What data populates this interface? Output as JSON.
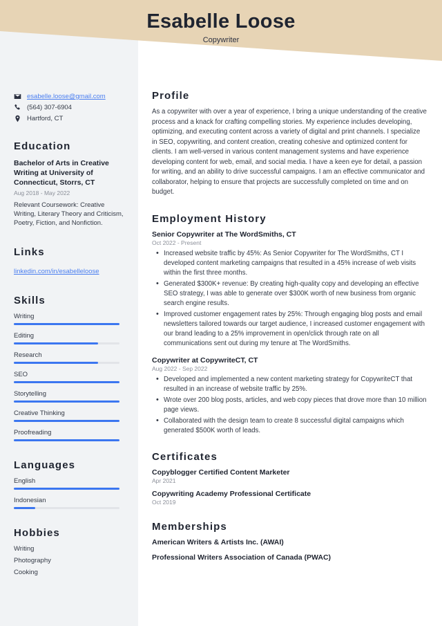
{
  "colors": {
    "header_band": "#e7d4b5",
    "sidebar_bg": "#f1f3f5",
    "accent_blue": "#3b76f0",
    "link_blue": "#4a7ef0",
    "heading_dark": "#1f2430",
    "muted_gray": "#8b8f99"
  },
  "header": {
    "name": "Esabelle Loose",
    "title": "Copywriter"
  },
  "contact": {
    "email": "esabelle.loose@gmail.com",
    "phone": "(564) 307-6904",
    "location": "Hartford, CT",
    "email_icon": "envelope-icon",
    "phone_icon": "phone-icon",
    "location_icon": "map-pin-icon"
  },
  "sidebar": {
    "education": {
      "heading": "Education",
      "entries": [
        {
          "degree": "Bachelor of Arts in Creative Writing at University of Connecticut, Storrs, CT",
          "date": "Aug 2018 - May 2022",
          "description": "Relevant Coursework: Creative Writing, Literary Theory and Criticism, Poetry, Fiction, and Nonfiction."
        }
      ]
    },
    "links": {
      "heading": "Links",
      "items": [
        {
          "label": "linkedin.com/in/esabelleloose"
        }
      ]
    },
    "skills": {
      "heading": "Skills",
      "items": [
        {
          "label": "Writing",
          "level": 100
        },
        {
          "label": "Editing",
          "level": 80
        },
        {
          "label": "Research",
          "level": 80
        },
        {
          "label": "SEO",
          "level": 100
        },
        {
          "label": "Storytelling",
          "level": 100
        },
        {
          "label": "Creative Thinking",
          "level": 100
        },
        {
          "label": "Proofreading",
          "level": 100
        }
      ]
    },
    "languages": {
      "heading": "Languages",
      "items": [
        {
          "label": "English",
          "level": 100
        },
        {
          "label": "Indonesian",
          "level": 20
        }
      ]
    },
    "hobbies": {
      "heading": "Hobbies",
      "items": [
        {
          "label": "Writing"
        },
        {
          "label": "Photography"
        },
        {
          "label": "Cooking"
        }
      ]
    }
  },
  "main": {
    "profile": {
      "heading": "Profile",
      "text": "As a copywriter with over a year of experience, I bring a unique understanding of the creative process and a knack for crafting compelling stories. My experience includes developing, optimizing, and executing content across a variety of digital and print channels. I specialize in SEO, copywriting, and content creation, creating cohesive and optimized content for clients. I am well-versed in various content management systems and have experience developing content for web, email, and social media. I have a keen eye for detail, a passion for writing, and an ability to drive successful campaigns. I am an effective communicator and collaborator, helping to ensure that projects are successfully completed on time and on budget."
    },
    "employment": {
      "heading": "Employment History",
      "jobs": [
        {
          "title": "Senior Copywriter at The WordSmiths, CT",
          "date": "Oct 2022 - Present",
          "bullets": [
            "Increased website traffic by 45%: As Senior Copywriter for The WordSmiths, CT I developed content marketing campaigns that resulted in a 45% increase of web visits within the first three months.",
            "Generated $300K+ revenue: By creating high-quality copy and developing an effective SEO strategy, I was able to generate over $300K worth of new business from organic search engine results.",
            "Improved customer engagement rates by 25%: Through engaging blog posts and email newsletters tailored towards our target audience, I increased customer engagement with our brand leading to a 25% improvement in open/click through rate on all communications sent out during my tenure at The WordSmiths."
          ]
        },
        {
          "title": "Copywriter at CopywriteCT, CT",
          "date": "Aug 2022 - Sep 2022",
          "bullets": [
            "Developed and implemented a new content marketing strategy for CopywriteCT that resulted in an increase of website traffic by 25%.",
            "Wrote over 200 blog posts, articles, and web copy pieces that drove more than 10 million page views.",
            "Collaborated with the design team to create 8 successful digital campaigns which generated $500K worth of leads."
          ]
        }
      ]
    },
    "certificates": {
      "heading": "Certificates",
      "items": [
        {
          "name": "Copyblogger Certified Content Marketer",
          "date": "Apr 2021"
        },
        {
          "name": "Copywriting Academy Professional Certificate",
          "date": "Oct 2019"
        }
      ]
    },
    "memberships": {
      "heading": "Memberships",
      "items": [
        {
          "name": "American Writers & Artists Inc. (AWAI)"
        },
        {
          "name": "Professional Writers Association of Canada (PWAC)"
        }
      ]
    }
  }
}
